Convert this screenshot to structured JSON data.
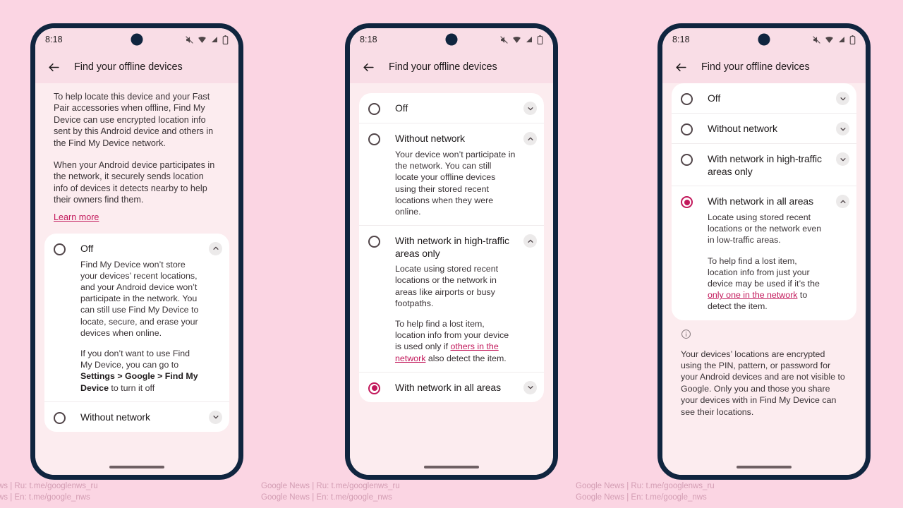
{
  "app": {
    "title": "Find your offline devices",
    "status_bar": {
      "time": "8:18",
      "icons": [
        "mute-icon",
        "wifi-icon",
        "signal-icon",
        "battery-icon"
      ]
    },
    "back_icon": "back-arrow-icon",
    "accent_color": "#c2185b",
    "background_color": "#fbd5e3",
    "header_color": "#f9dde6",
    "surface_color": "#fcecef",
    "card_color": "#ffffff"
  },
  "intro": {
    "paragraph_1": "To help locate this device and your Fast Pair accessories when offline, Find My Device can use encrypted location info sent by this Android device and others in the Find My Device network.",
    "paragraph_2": "When your Android device participates in the network, it securely sends location info of devices it detects nearby to help their owners find them.",
    "learn_more": "Learn more"
  },
  "options": {
    "off": {
      "title": "Off",
      "body_1": "Find My Device won’t store your devices’ recent locations, and your Android device won’t participate in the network. You can still use Find My Device to locate, secure, and erase your devices when online.",
      "body_2_pre": "If you don’t want to use Find My Device, you can go to ",
      "body_2_bold": "Settings > Google > Find My Device",
      "body_2_post": " to turn it off"
    },
    "without_network": {
      "title": "Without network",
      "body_1": "Your device won’t participate in the network. You can still locate your offline devices using their stored recent locations when they were online."
    },
    "high_traffic": {
      "title": "With network in high-traffic areas only",
      "body_1": "Locate using stored recent locations or the network in areas like airports or busy footpaths.",
      "body_2_pre": "To help find a lost item, location info from your device is used only if ",
      "body_2_link": "others in the network",
      "body_2_post": " also detect the item."
    },
    "all_areas": {
      "title": "With network in all areas",
      "body_1": "Locate using stored recent locations or the network even in low-traffic areas.",
      "body_2_pre": "To help find a lost item, location info from just your device may be used if it’s the ",
      "body_2_link": "only one in the network",
      "body_2_post": " to detect the item."
    }
  },
  "footnote": {
    "icon": "info-icon",
    "text": "Your devices’ locations are encrypted using the PIN, pattern, or password for your Android devices and are not visible to Google. Only you and those you share your devices with in Find My Device can see their locations."
  },
  "watermark": {
    "line_1": "Google News | Ru: t.me/googlenws_ru",
    "line_2": "Google News | En: t.me/google_nws"
  },
  "screens": {
    "screen_1": {
      "name": "intro-with-off-expanded",
      "selected": "all_areas",
      "expanded": "off"
    },
    "screen_2": {
      "name": "options-list-scrolled",
      "selected": "all_areas",
      "expanded": "without_network,high_traffic"
    },
    "screen_3": {
      "name": "all-areas-expanded",
      "selected": "all_areas",
      "expanded": "all_areas"
    }
  }
}
